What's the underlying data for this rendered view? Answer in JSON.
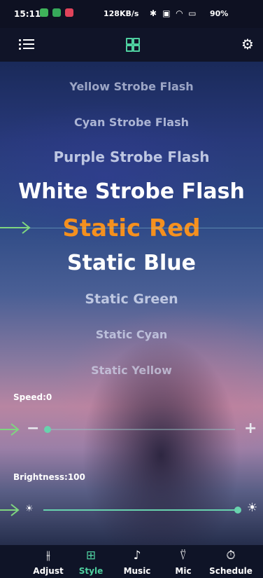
{
  "status_bar": {
    "time": "15:11",
    "net_speed": "128KB/s",
    "icons": [
      "bluetooth-icon",
      "sim-icon",
      "wifi-icon"
    ],
    "battery": "90%"
  },
  "app_bar": {
    "icons": [
      "menu-icon",
      "grid-icon",
      "gear-icon"
    ]
  },
  "style_list": {
    "items": [
      "Yellow Strobe Flash",
      "Cyan Strobe Flash",
      "Purple Strobe Flash",
      "White Strobe Flash",
      "Static Red",
      "Static Blue",
      "Static Green",
      "Static Cyan",
      "Static Yellow"
    ],
    "selected": "Static Red"
  },
  "speed": {
    "label": "Speed:0",
    "value": 0,
    "minus": "−",
    "plus": "+"
  },
  "brightness": {
    "label": "Brightness:100",
    "value": 100
  },
  "tabs": [
    {
      "label": "Adjust",
      "icon": "sliders-icon",
      "active": false
    },
    {
      "label": "Style",
      "icon": "grid-icon",
      "active": true
    },
    {
      "label": "Music",
      "icon": "music-icon",
      "active": false
    },
    {
      "label": "Mic",
      "icon": "mic-icon",
      "active": false
    },
    {
      "label": "Schedule",
      "icon": "timer-icon",
      "active": false
    }
  ],
  "colors": {
    "accent": "#4fd0a0",
    "selected_text": "#f5901e",
    "track": "#68d3ae",
    "arrow": "#7fd67f"
  }
}
